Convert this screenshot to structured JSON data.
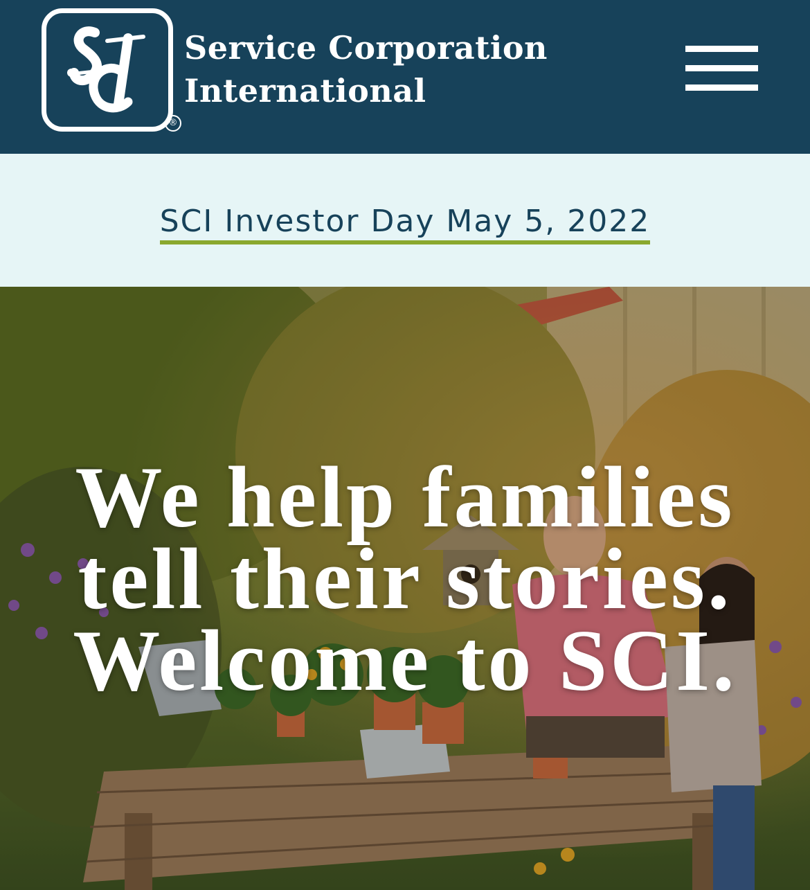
{
  "header": {
    "logo_monogram": "SCI",
    "brand_line1": "Service Corporation",
    "brand_line2": "International",
    "registered_mark": "®",
    "menu_icon": "hamburger-menu-icon"
  },
  "banner": {
    "link_text": "SCI Investor Day May 5, 2022"
  },
  "hero": {
    "line1": "We help families",
    "line2": "tell their stories.",
    "line3": "Welcome to SCI."
  },
  "colors": {
    "header_bg": "#17425a",
    "banner_bg": "#e6f5f6",
    "link_text": "#17425a",
    "link_underline": "#8aa82e",
    "hero_text": "#ffffff"
  }
}
